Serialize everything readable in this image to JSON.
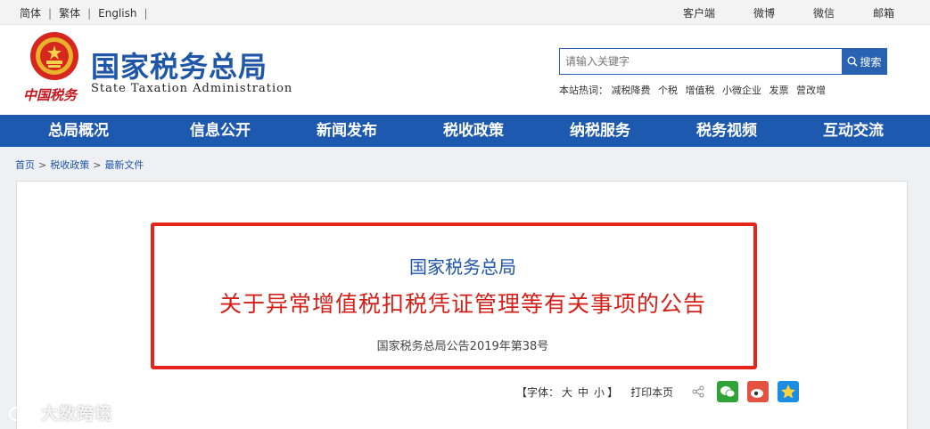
{
  "topbar": {
    "languages": [
      "简体",
      "繁体",
      "English"
    ],
    "links": [
      "客户端",
      "微博",
      "微信",
      "邮箱"
    ]
  },
  "header": {
    "logo_text": "中国税务",
    "title": "国家税务总局",
    "subtitle": "State Taxation Administration",
    "search": {
      "placeholder": "请输入关键字",
      "button": "搜索"
    },
    "hot_label": "本站热词：",
    "hot_words": [
      "减税降费",
      "个税",
      "增值税",
      "小微企业",
      "发票",
      "营改增"
    ]
  },
  "nav": [
    "总局概况",
    "信息公开",
    "新闻发布",
    "税收政策",
    "纳税服务",
    "税务视频",
    "互动交流"
  ],
  "breadcrumb": [
    "首页",
    "税收政策",
    "最新文件"
  ],
  "article": {
    "issuer": "国家税务总局",
    "title": "关于异常增值税扣税凭证管理等有关事项的公告",
    "number": "国家税务总局公告2019年第38号"
  },
  "tools": {
    "font_label": "【字体：",
    "font_sizes": [
      "大",
      "中",
      "小"
    ],
    "font_close": "】",
    "print": "打印本页"
  },
  "watermark": "大数跨境",
  "colors": {
    "brand_blue": "#1d5aaf",
    "highlight_red": "#e5241b",
    "title_red": "#d42019"
  }
}
